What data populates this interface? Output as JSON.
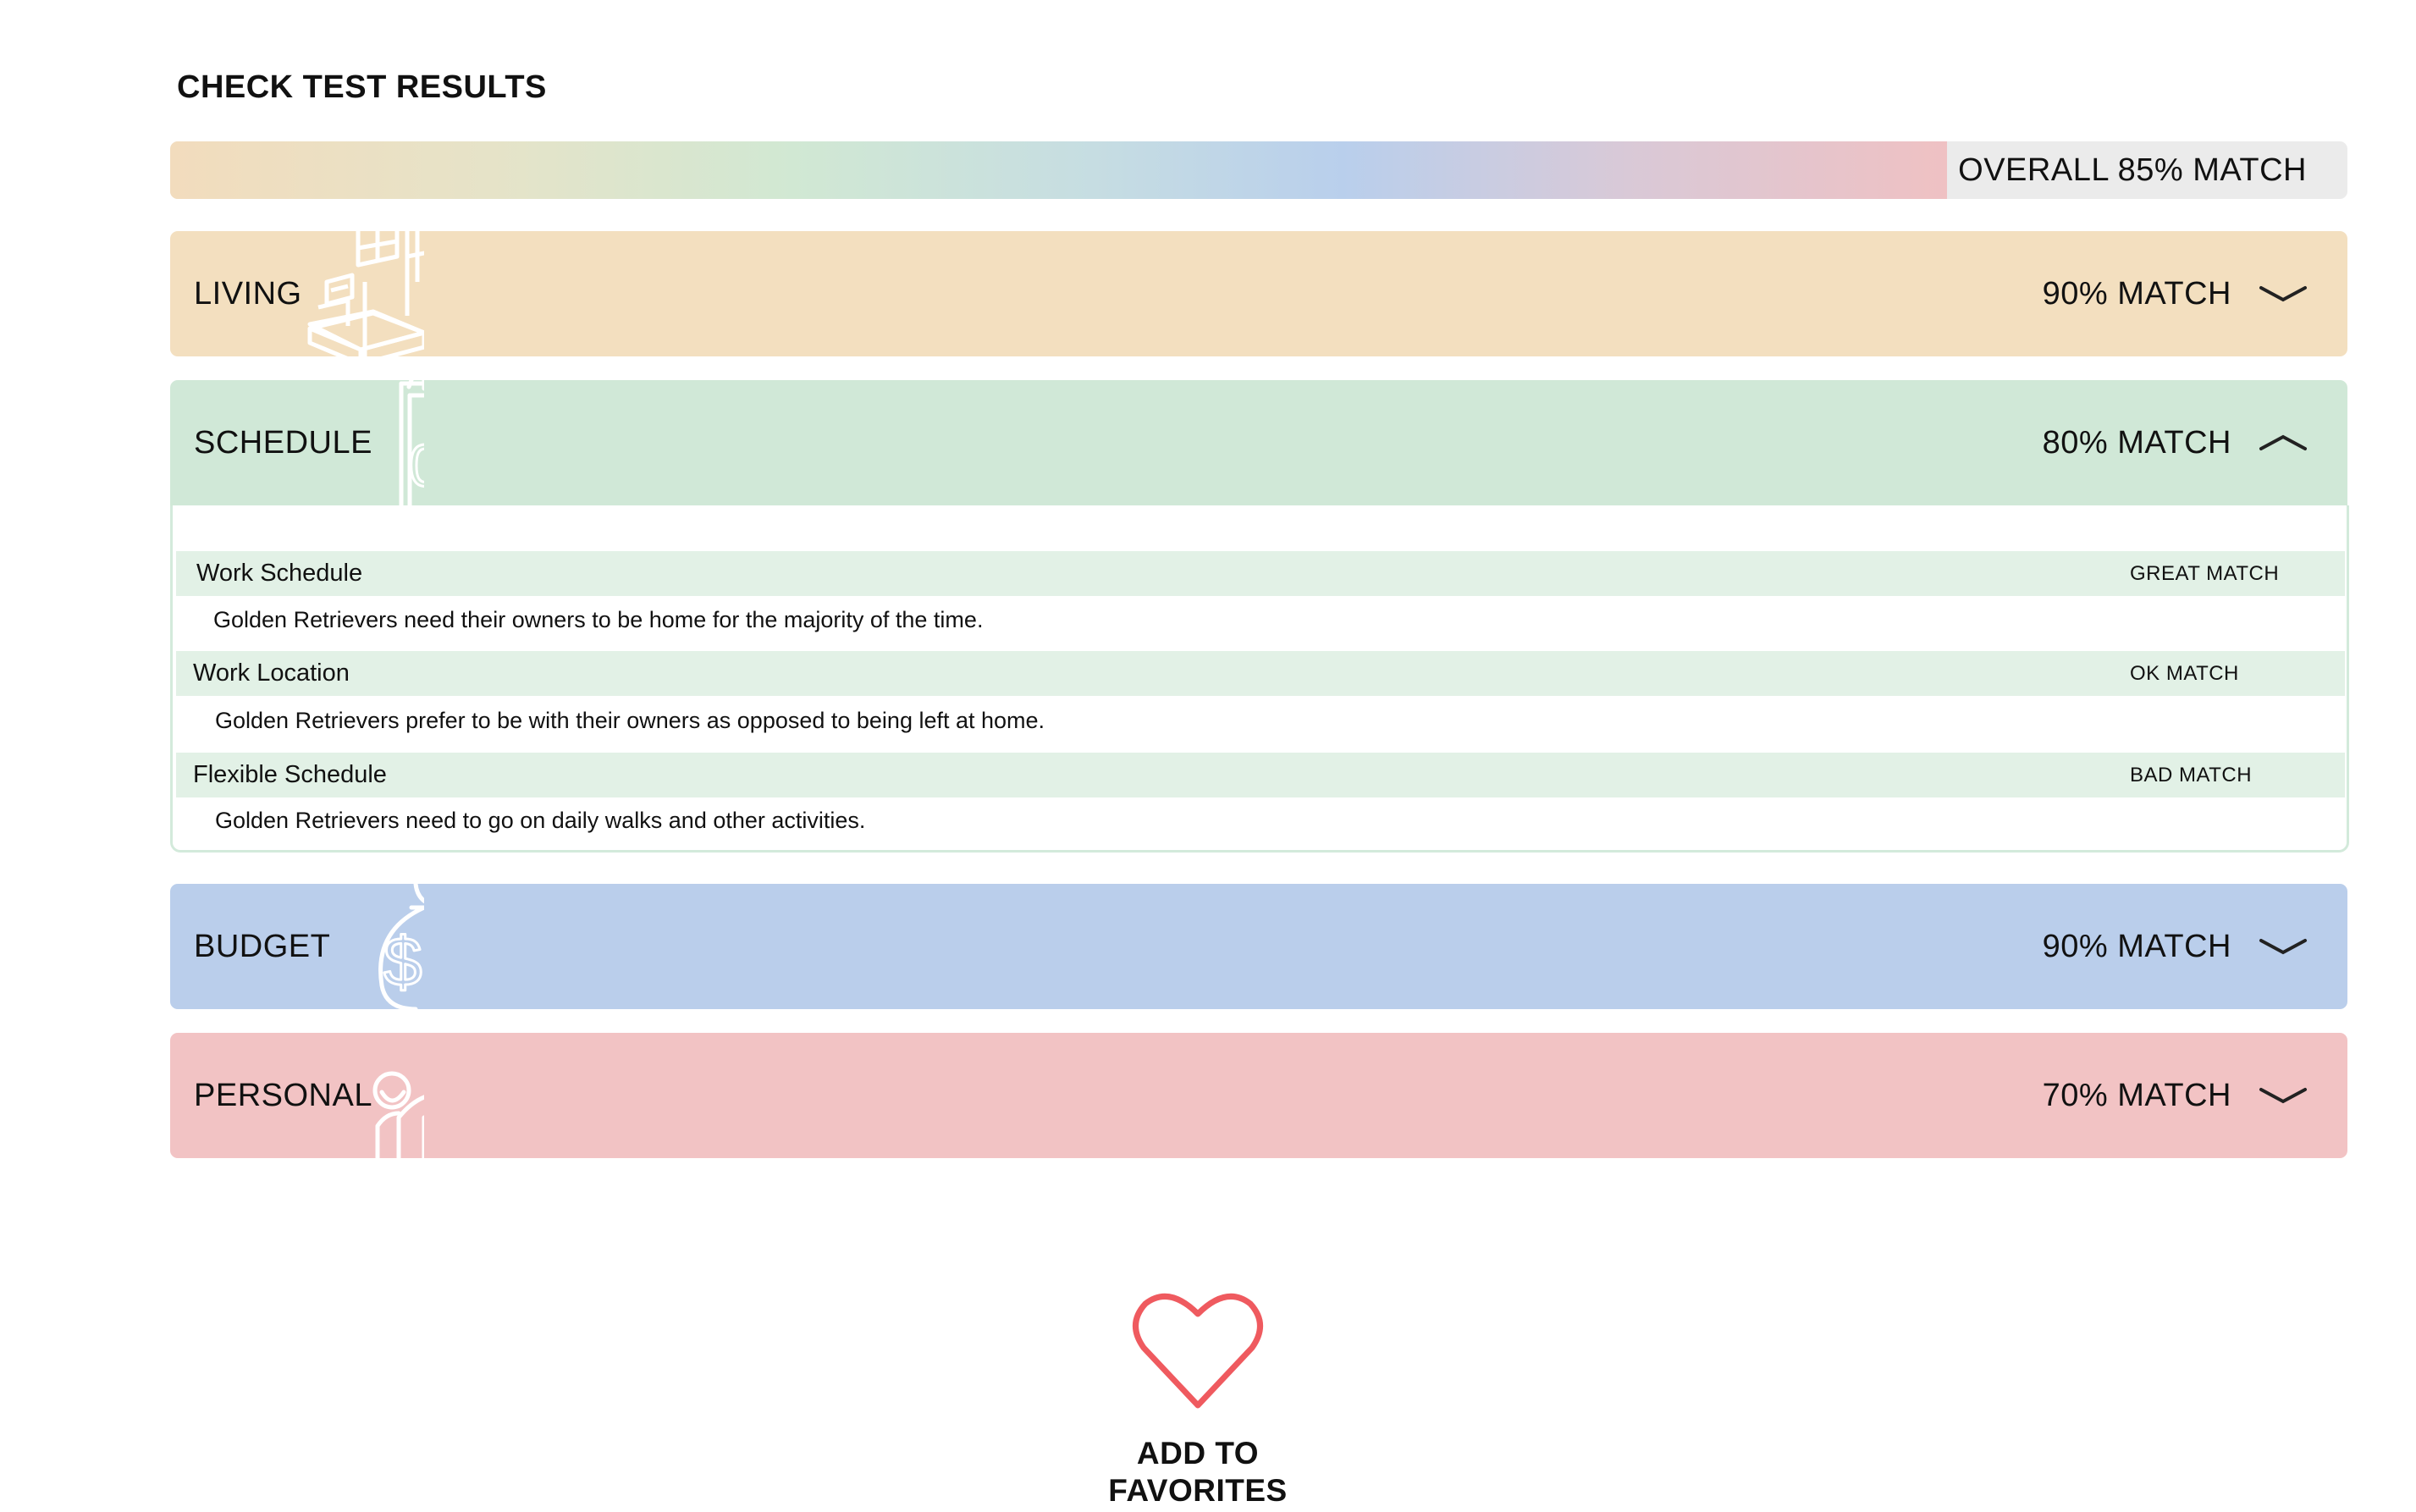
{
  "page": {
    "title": "CHECK TEST RESULTS"
  },
  "overall": {
    "label": "OVERALL 85% MATCH",
    "percent": 85
  },
  "categories": [
    {
      "name": "LIVING",
      "match": "90% MATCH",
      "color": "#f3dfbf",
      "expanded": false,
      "icon": "room-isometric-icon"
    },
    {
      "name": "SCHEDULE",
      "match": "80% MATCH",
      "color": "#d0e8d7",
      "expanded": true,
      "icon": "calendar-icon"
    },
    {
      "name": "BUDGET",
      "match": "90% MATCH",
      "color": "#baceeb",
      "expanded": false,
      "icon": "money-calculator-icon"
    },
    {
      "name": "PERSONAL",
      "match": "70% MATCH",
      "color": "#f2c3c4",
      "expanded": false,
      "icon": "people-group-icon"
    }
  ],
  "schedule_details": [
    {
      "title": "Work Schedule",
      "badge": "GREAT MATCH",
      "description": "Golden Retrievers need their owners to be home for the majority of the time."
    },
    {
      "title": "Work Location",
      "badge": "OK MATCH",
      "description": "Golden Retrievers prefer to be with their owners as opposed to being left at home."
    },
    {
      "title": "Flexible Schedule",
      "badge": "BAD MATCH",
      "description": "Golden Retrievers need to go on daily walks and other activities."
    }
  ],
  "favorites": {
    "line1": "ADD TO",
    "line2": "FAVORITES",
    "icon": "heart-outline-icon",
    "color": "#ef5a5f"
  }
}
